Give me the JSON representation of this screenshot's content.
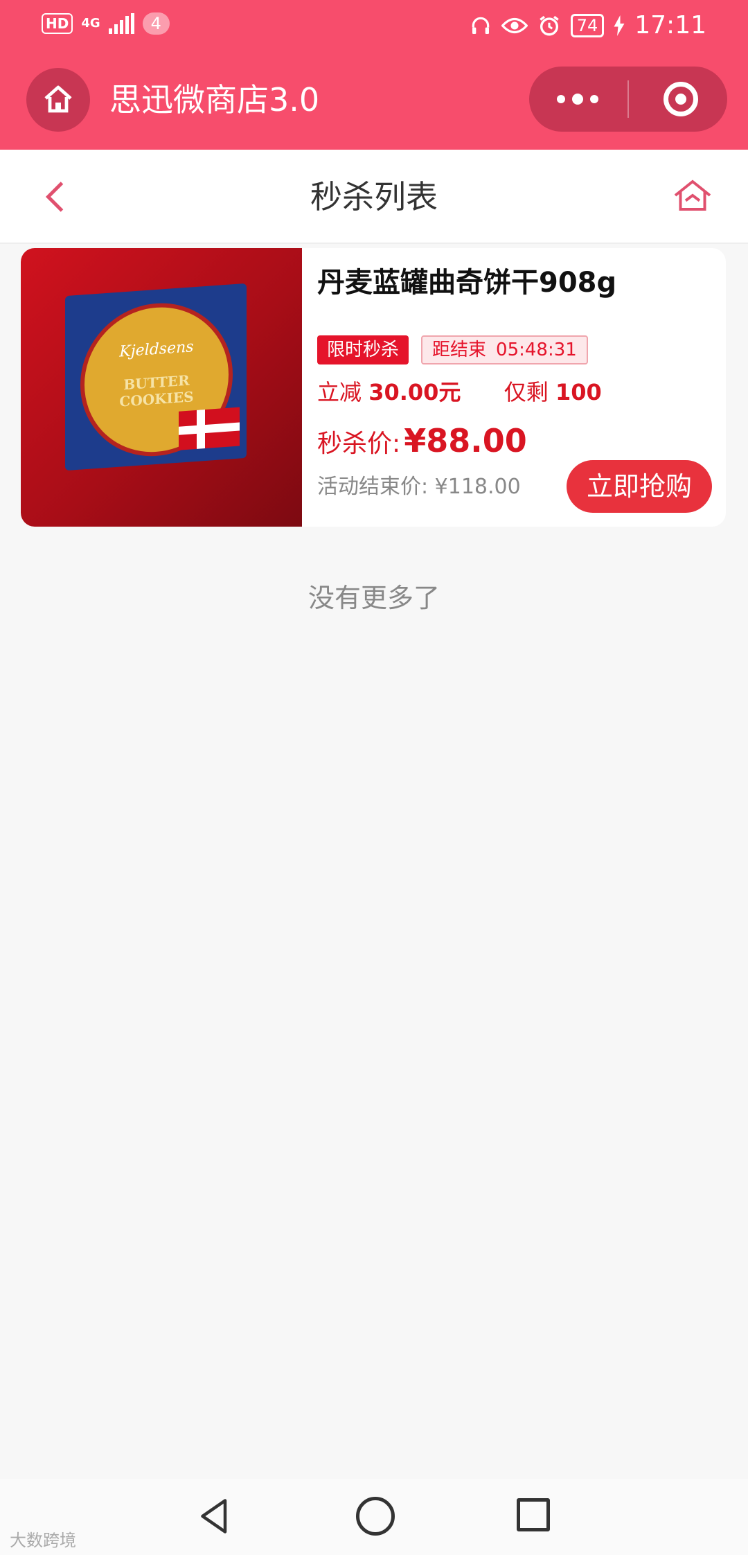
{
  "status_bar": {
    "hd": "HD",
    "network": "4G",
    "notification_count": "4",
    "battery": "74",
    "time": "17:11",
    "icons": [
      "headphones-icon",
      "eye-icon",
      "alarm-icon",
      "charging-icon"
    ]
  },
  "mini_program": {
    "title": "思迅微商店3.0",
    "home_icon": "home-icon",
    "menu_icon": "more-dots-icon",
    "close_icon": "target-circle-icon"
  },
  "header": {
    "title": "秒杀列表",
    "back_icon": "chevron-left-icon",
    "home_icon": "house-outline-icon"
  },
  "product": {
    "name": "丹麦蓝罐曲奇饼干908g",
    "image": {
      "brand": "Kjeldsens",
      "text": "BUTTER COOKIES"
    },
    "tag_flash": "限时秒杀",
    "countdown_label": "距结束",
    "countdown": "05:48:31",
    "discount_label": "立减",
    "discount_value": "30.00元",
    "stock_label": "仅剩",
    "stock_value": "100",
    "flash_price_label": "秒杀价:",
    "flash_price": "¥88.00",
    "end_price_label": "活动结束价:",
    "end_price": "¥118.00",
    "buy_label": "立即抢购"
  },
  "list_end": "没有更多了",
  "navbar": {
    "icons": [
      "nav-back-icon",
      "nav-home-icon",
      "nav-recent-icon"
    ]
  },
  "watermark": "大数跨境",
  "colors": {
    "accent": "#f74d6c",
    "capsule": "#c83653",
    "price_red": "#d91522",
    "buy_button": "#e8323d"
  }
}
